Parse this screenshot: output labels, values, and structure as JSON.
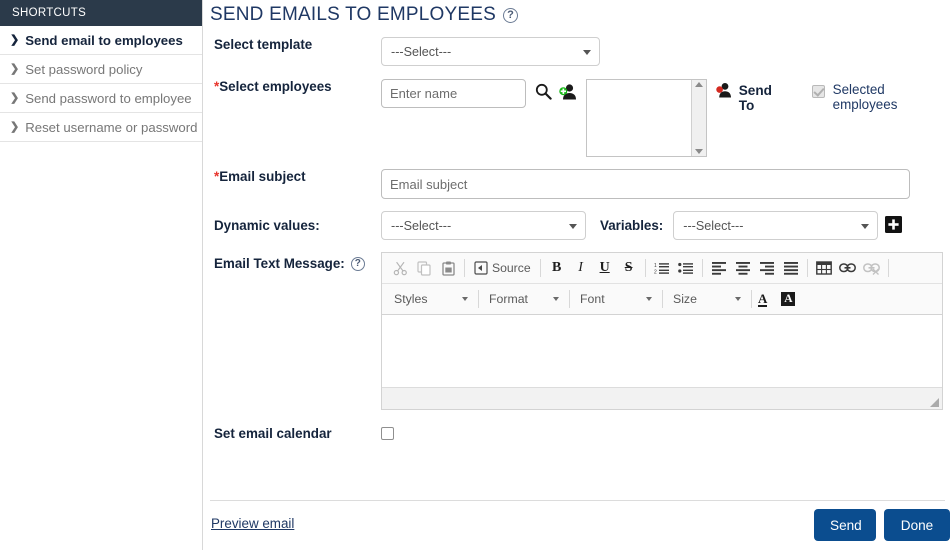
{
  "sidebar": {
    "header": "SHORTCUTS",
    "items": [
      {
        "label": "Send email to employees",
        "active": true
      },
      {
        "label": "Set password policy",
        "active": false
      },
      {
        "label": "Send password to employee",
        "active": false
      },
      {
        "label": "Reset username or password",
        "active": false
      }
    ]
  },
  "page": {
    "title": "SEND EMAILS TO EMPLOYEES",
    "help_icon": "help-circle-icon",
    "title_color": "#1f3864"
  },
  "form": {
    "select_template": {
      "label": "Select template",
      "value": "---Select---"
    },
    "select_employees": {
      "label": "Select employees",
      "required_marker": "*",
      "name_placeholder": "Enter name",
      "name_value": "",
      "search_icon": "search-icon",
      "add_employee_icon": "add-person-icon",
      "listbox_items": []
    },
    "send_to": {
      "icon": "recipients-person-icon",
      "label": "Send To",
      "checkbox_label": "Selected employees",
      "checkbox_checked": true,
      "checkbox_disabled": true
    },
    "email_subject": {
      "label": "Email subject",
      "required_marker": "*",
      "placeholder": "Email subject",
      "value": ""
    },
    "dynamic_values": {
      "label": "Dynamic values:",
      "value": "---Select---"
    },
    "variables": {
      "label": "Variables:",
      "value": "---Select---",
      "add_button_icon": "plus-square-icon"
    },
    "email_text_message": {
      "label": "Email Text Message:",
      "help_icon": "help-circle-icon",
      "body_value": ""
    },
    "set_email_calendar": {
      "label": "Set email calendar",
      "checked": false
    }
  },
  "editor": {
    "toolbar_row1": [
      {
        "name": "cut-icon",
        "glyph": "✂",
        "label": "Cut"
      },
      {
        "name": "copy-icon",
        "glyph": "⧉",
        "label": "Copy"
      },
      {
        "name": "paste-icon",
        "glyph": "Ὄb",
        "label": "Paste"
      },
      {
        "name": "source-icon",
        "glyph": "◈",
        "label": "Source"
      },
      {
        "name": "bold-icon",
        "glyph": "B",
        "label": "Bold"
      },
      {
        "name": "italic-icon",
        "glyph": "I",
        "label": "Italic"
      },
      {
        "name": "underline-icon",
        "glyph": "U",
        "label": "Underline"
      },
      {
        "name": "strikethrough-icon",
        "glyph": "S",
        "label": "Strikethrough"
      },
      {
        "name": "numbered-list-icon",
        "glyph": "",
        "label": "Insert/Remove Numbered List"
      },
      {
        "name": "bulleted-list-icon",
        "glyph": "",
        "label": "Insert/Remove Bulleted List"
      },
      {
        "name": "align-left-icon",
        "glyph": "",
        "label": "Align Left"
      },
      {
        "name": "align-center-icon",
        "glyph": "",
        "label": "Center"
      },
      {
        "name": "align-right-icon",
        "glyph": "",
        "label": "Align Right"
      },
      {
        "name": "justify-icon",
        "glyph": "",
        "label": "Justify"
      },
      {
        "name": "table-icon",
        "glyph": "",
        "label": "Table"
      },
      {
        "name": "link-icon",
        "glyph": "",
        "label": "Link"
      },
      {
        "name": "unlink-icon",
        "glyph": "",
        "label": "Unlink"
      }
    ],
    "source_label": "Source",
    "combos": [
      {
        "name": "styles-combo",
        "label": "Styles"
      },
      {
        "name": "format-combo",
        "label": "Format"
      },
      {
        "name": "font-combo",
        "label": "Font"
      },
      {
        "name": "size-combo",
        "label": "Size"
      }
    ],
    "text_color": {
      "name": "text-color-icon",
      "glyph": "A"
    },
    "bg_color": {
      "name": "background-color-icon",
      "glyph": "A"
    }
  },
  "footer": {
    "preview_link": "Preview email",
    "send_label": "Send",
    "done_label": "Done",
    "button_color": "#0b4d8f"
  }
}
